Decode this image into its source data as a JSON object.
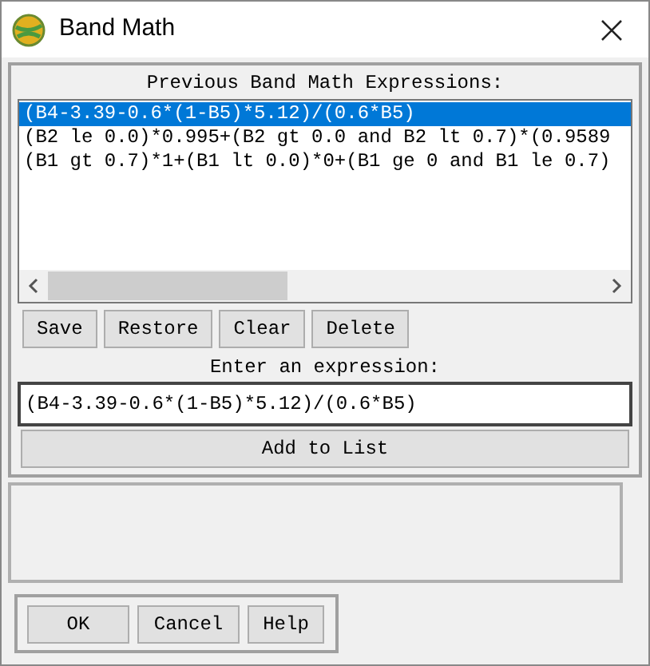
{
  "window": {
    "title": "Band Math"
  },
  "previous": {
    "label": "Previous Band Math Expressions:",
    "items": [
      {
        "text": "(B4-3.39-0.6*(1-B5)*5.12)/(0.6*B5)",
        "selected": true
      },
      {
        "text": "(B2 le 0.0)*0.995+(B2 gt 0.0 and B2 lt 0.7)*(0.9589",
        "selected": false
      },
      {
        "text": "(B1 gt 0.7)*1+(B1 lt 0.0)*0+(B1 ge 0 and B1 le 0.7)",
        "selected": false
      }
    ]
  },
  "list_buttons": [
    "Save",
    "Restore",
    "Clear",
    "Delete"
  ],
  "expression": {
    "label": "Enter an expression:",
    "value": "(B4-3.39-0.6*(1-B5)*5.12)/(0.6*B5)"
  },
  "add_button": "Add to List",
  "dialog_buttons": [
    "OK",
    "Cancel",
    "Help"
  ]
}
